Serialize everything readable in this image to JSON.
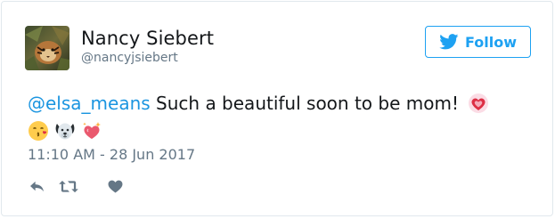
{
  "tweet": {
    "display_name": "Nancy Siebert",
    "handle": "@nancyjsiebert",
    "mention": "@elsa_means",
    "text": " Such a beautiful soon to be mom!",
    "timestamp": "11:10 AM - 28 Jun 2017",
    "emojis": [
      "sparkling-heart-emoji",
      "kissing-face-emoji",
      "dog-face-emoji",
      "heart-with-sparkles-emoji"
    ]
  },
  "follow_button": {
    "label": "Follow",
    "icon": "twitter-bird-icon"
  },
  "actions": {
    "reply_icon": "reply-icon",
    "retweet_icon": "retweet-icon",
    "like_icon": "heart-icon"
  },
  "colors": {
    "brand_blue": "#1da1f2",
    "mention_blue": "#1b95e0",
    "text_dark": "#14171a",
    "text_gray": "#657786",
    "action_gray": "#657786",
    "border": "#e1e8ed"
  }
}
